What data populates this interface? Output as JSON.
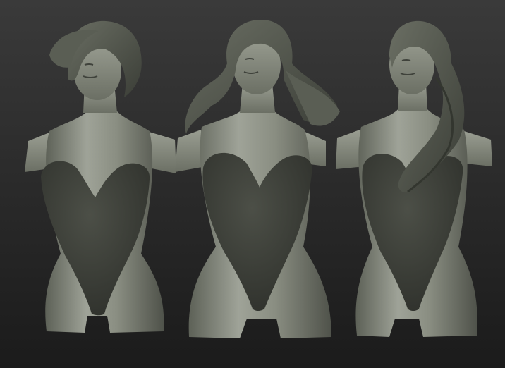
{
  "scene": {
    "background_top": "#3a3a3a",
    "background_bottom": "#1a1a1a",
    "clay_light": "#9ea296",
    "clay_mid": "#7d8175",
    "clay_dark": "#4a4d45",
    "suit_color": "#3d3f39",
    "hair_color": "#4e5249"
  },
  "figures": [
    {
      "id": "left",
      "hair_style": "short-swept"
    },
    {
      "id": "center",
      "hair_style": "long-wavy"
    },
    {
      "id": "right",
      "hair_style": "long-side-draped"
    }
  ]
}
